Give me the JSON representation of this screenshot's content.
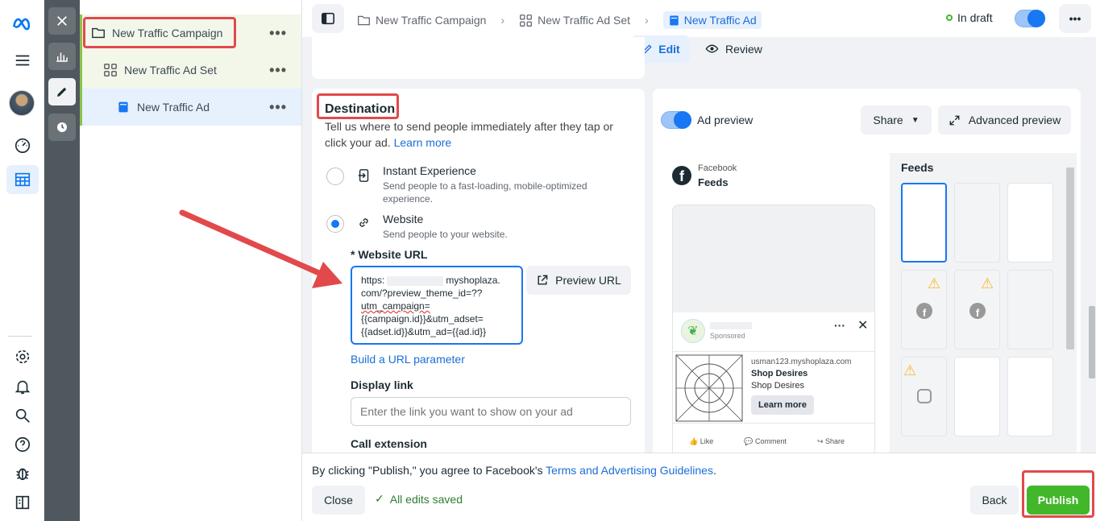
{
  "tree": {
    "campaign": "New Traffic Campaign",
    "adset": "New Traffic Ad Set",
    "ad": "New Traffic Ad",
    "more": "•••"
  },
  "breadcrumb": {
    "campaign": "New Traffic Campaign",
    "adset": "New Traffic Ad Set",
    "ad": "New Traffic Ad"
  },
  "status": {
    "label": "In draft"
  },
  "tabs": {
    "edit": "Edit",
    "review": "Review"
  },
  "destination": {
    "title": "Destination",
    "description": "Tell us where to send people immediately after they tap or click your ad.",
    "learn_more": "Learn more",
    "instant_label": "Instant Experience",
    "instant_desc": "Send people to a fast-loading, mobile-optimized experience.",
    "website_label": "Website",
    "website_desc": "Send people to your website.",
    "url_label": "* Website URL",
    "url_line1a": "https:",
    "url_line1b": "myshoplaza.",
    "url_line2": "com/?preview_theme_id=??",
    "url_line3": "utm_campaign=",
    "url_line4": "{{campaign.id}}&utm_adset=",
    "url_line5": "{{adset.id}}&utm_ad={{ad.id}}",
    "preview_url": "Preview URL",
    "build_param": "Build a URL parameter",
    "display_link_label": "Display link",
    "display_link_placeholder": "Enter the link you want to show on your ad",
    "call_extension": "Call extension"
  },
  "preview": {
    "toggle_label": "Ad preview",
    "share": "Share",
    "advanced": "Advanced preview",
    "platform": "Facebook",
    "placement": "Feeds",
    "panel_title": "Feeds",
    "sponsored": "Sponsored",
    "url": "usman123.myshoplaza.com",
    "headline": "Shop Desires",
    "desc": "Shop Desires",
    "cta": "Learn more",
    "like": "Like",
    "comment": "Comment",
    "share_action": "Share"
  },
  "footer": {
    "terms_prefix": "By clicking \"Publish,\" you agree to Facebook's ",
    "terms_link": "Terms and Advertising Guidelines",
    "terms_suffix": ".",
    "close": "Close",
    "saved": "All edits saved",
    "back": "Back",
    "publish": "Publish"
  },
  "colors": {
    "accent": "#1877f2",
    "publish": "#42b72a",
    "annotation": "#e2494b"
  }
}
